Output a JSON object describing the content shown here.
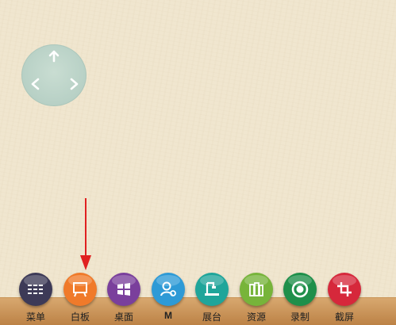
{
  "dpad": {
    "up_icon": "arrow-up-icon",
    "left_icon": "chevron-left-icon",
    "right_icon": "chevron-right-icon"
  },
  "annotation": {
    "icon": "red-down-arrow",
    "color": "#e02020"
  },
  "dock": {
    "items": [
      {
        "label": "菜单",
        "icon": "menu-grid-icon",
        "color": "#3d3a57"
      },
      {
        "label": "白板",
        "icon": "whiteboard-icon",
        "color": "#f07a2a"
      },
      {
        "label": "桌面",
        "icon": "windows-icon",
        "color": "#7a3f9c"
      },
      {
        "label": "M",
        "icon": "user-link-icon",
        "color": "#2e9ad6"
      },
      {
        "label": "展台",
        "icon": "document-camera-icon",
        "color": "#1fa59a"
      },
      {
        "label": "资源",
        "icon": "books-icon",
        "color": "#77b43a"
      },
      {
        "label": "录制",
        "icon": "record-icon",
        "color": "#1e8f4a"
      },
      {
        "label": "截屏",
        "icon": "crop-icon",
        "color": "#d6283b"
      }
    ]
  }
}
